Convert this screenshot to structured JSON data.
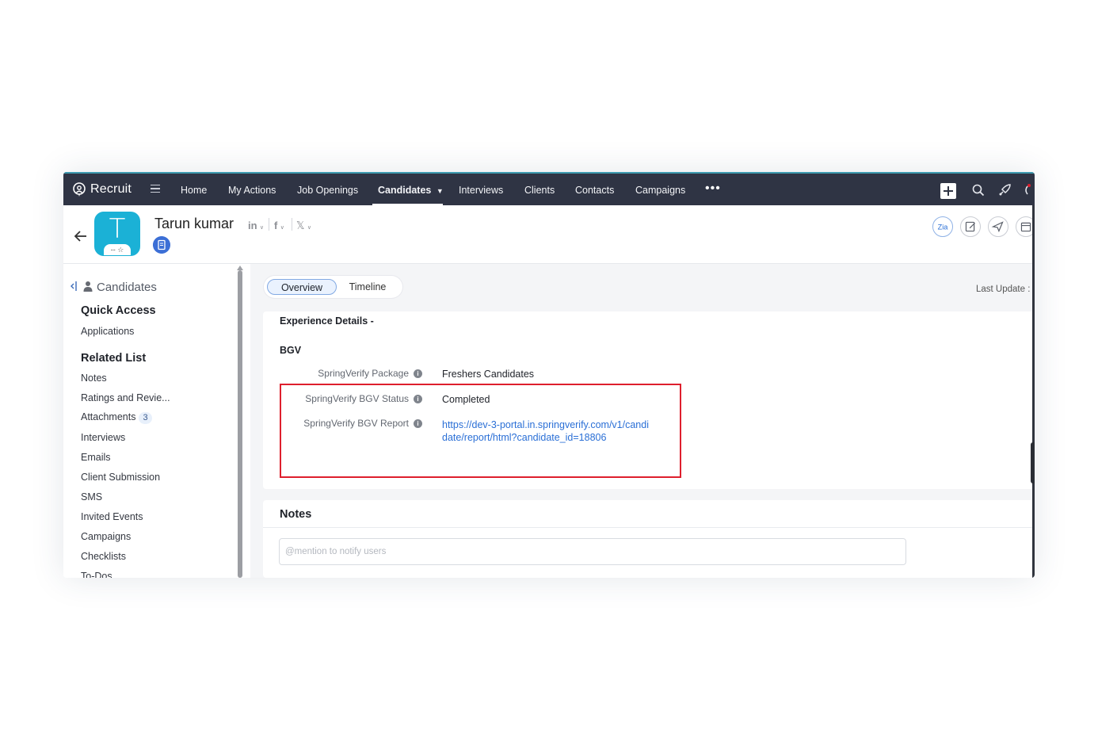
{
  "nav": {
    "brand": "Recruit",
    "items": [
      "Home",
      "My Actions",
      "Job Openings",
      "Candidates",
      "Interviews",
      "Clients",
      "Contacts",
      "Campaigns"
    ],
    "more": "•••",
    "active": "Candidates",
    "colors": {
      "bar": "#2f3444",
      "accent": "#3d9ab0"
    }
  },
  "header": {
    "avatar_letter": "T",
    "rating": "-- ☆",
    "name": "Tarun kumar",
    "social": {
      "linkedin": "in",
      "facebook": "f",
      "x": "𝕏"
    }
  },
  "sidebar": {
    "module": "Candidates",
    "quick_access_heading": "Quick Access",
    "quick_access": [
      "Applications"
    ],
    "related_heading": "Related List",
    "related": [
      {
        "label": "Notes"
      },
      {
        "label": "Ratings and Revie..."
      },
      {
        "label": "Attachments",
        "count": "3"
      },
      {
        "label": "Interviews"
      },
      {
        "label": "Emails"
      },
      {
        "label": "Client Submission"
      },
      {
        "label": "SMS"
      },
      {
        "label": "Invited Events"
      },
      {
        "label": "Campaigns"
      },
      {
        "label": "Checklists"
      },
      {
        "label": "To-Dos"
      }
    ]
  },
  "tabs": {
    "overview": "Overview",
    "timeline": "Timeline"
  },
  "last_update": "Last Update :",
  "details": {
    "experience_title": "Experience Details -",
    "bgv_title": "BGV",
    "package_label": "SpringVerify Package",
    "package_value": "Freshers Candidates",
    "status_label": "SpringVerify BGV Status",
    "status_value": "Completed",
    "report_label": "SpringVerify BGV Report",
    "report_value": "https://dev-3-portal.in.springverify.com/v1/candidate/report/html?candidate_id=18806",
    "highlight_color": "#de1f2d"
  },
  "notes": {
    "title": "Notes",
    "placeholder": "@mention to notify users"
  }
}
